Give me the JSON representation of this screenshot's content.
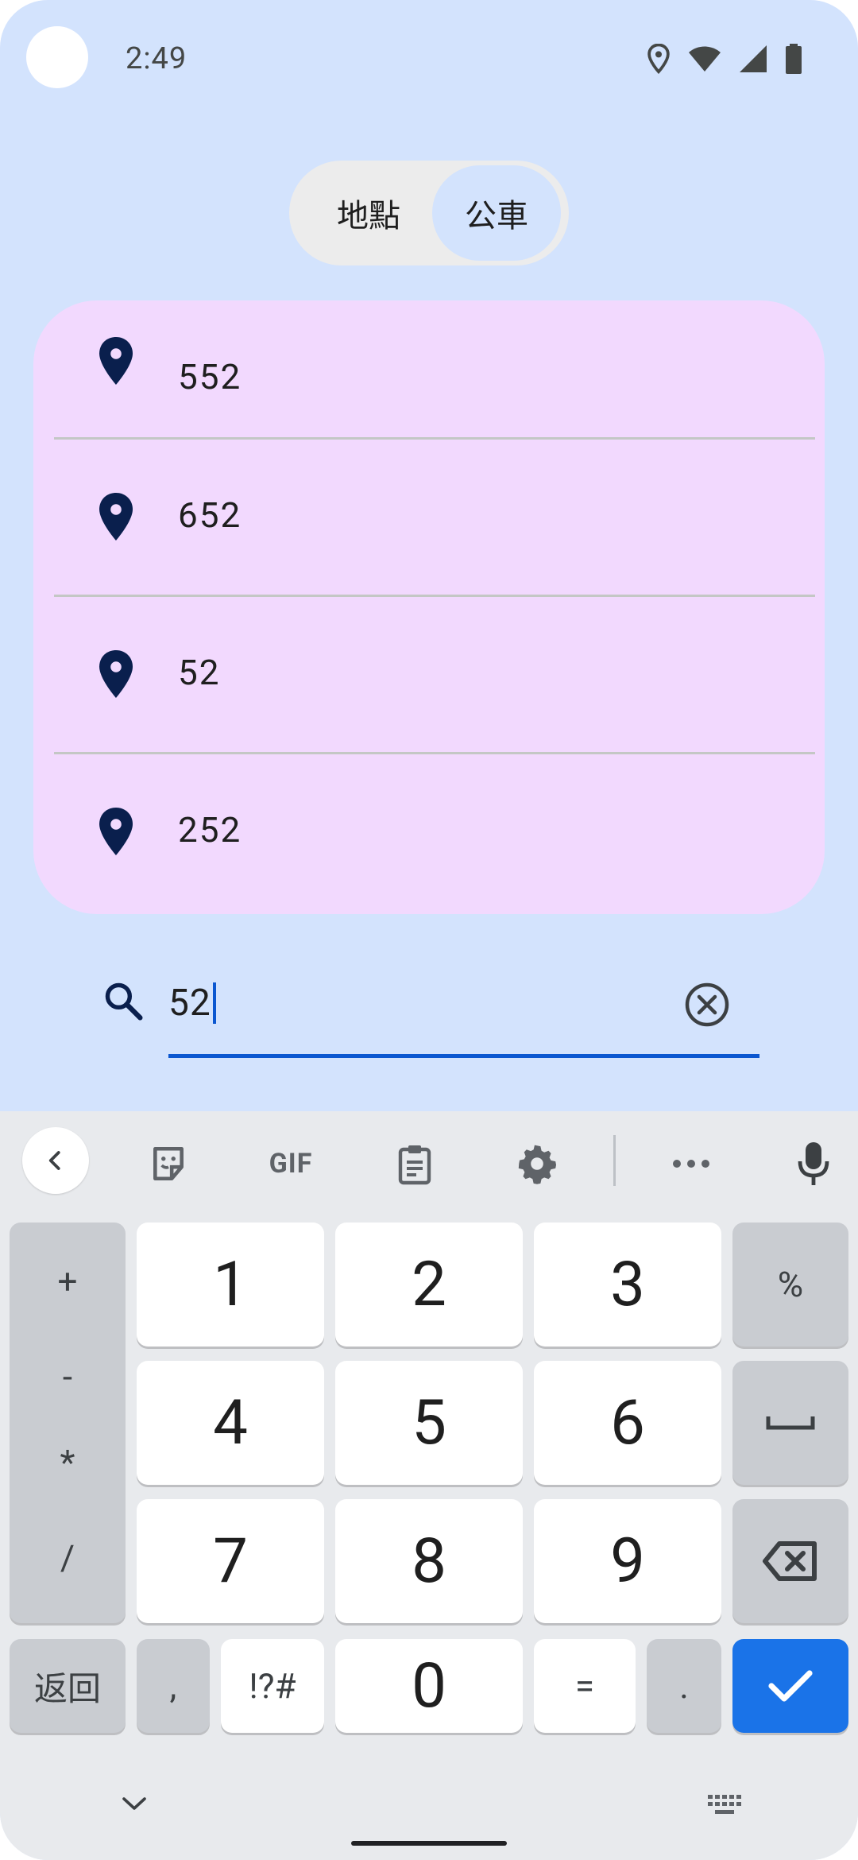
{
  "status_bar": {
    "time": "2:49",
    "icons": [
      "location-icon",
      "wifi-icon",
      "signal-icon",
      "battery-icon"
    ]
  },
  "toggle": {
    "options": [
      "地點",
      "公車"
    ],
    "selected": "公車"
  },
  "suggestions": [
    {
      "label": "552",
      "icon": "location-pin-icon"
    },
    {
      "label": "652",
      "icon": "location-pin-icon"
    },
    {
      "label": "52",
      "icon": "location-pin-icon"
    },
    {
      "label": "252",
      "icon": "location-pin-icon"
    }
  ],
  "search": {
    "value": "52",
    "icon": "search-icon",
    "clear_icon": "clear-icon"
  },
  "keyboard": {
    "toolbar": {
      "gif_label": "GIF",
      "icons": [
        "back-arrow-icon",
        "sticker-icon",
        "clipboard-icon",
        "settings-icon",
        "more-icon",
        "mic-icon"
      ]
    },
    "operators": [
      "+",
      "-",
      "*",
      "/"
    ],
    "digits": [
      "1",
      "2",
      "3",
      "4",
      "5",
      "6",
      "7",
      "8",
      "9",
      "0"
    ],
    "percent": "%",
    "back_label": "返回",
    "comma": ",",
    "symbols": "!?#",
    "equals": "=",
    "period": ".",
    "space_icon": "space-icon",
    "backspace_icon": "backspace-icon",
    "enter_icon": "check-icon"
  },
  "colors": {
    "background": "#d3e3fd",
    "card": "#f2d9fe",
    "accent": "#0b57d0",
    "enter_key": "#1a73e8",
    "pin": "#0a1f4d"
  }
}
